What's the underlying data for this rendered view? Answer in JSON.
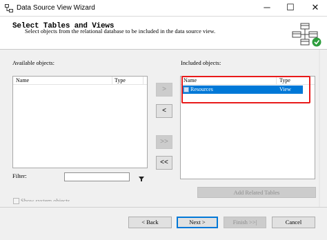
{
  "window": {
    "title": "Data Source View Wizard",
    "min_glyph": "─",
    "max_glyph": "☐",
    "close_glyph": "✕"
  },
  "header": {
    "title": "Select Tables and Views",
    "subtitle": "Select objects from the relational database to be included in the data source view."
  },
  "available": {
    "label": "Available objects:",
    "columns": [
      "Name",
      "Type"
    ],
    "rows": []
  },
  "included": {
    "label": "Included objects:",
    "columns": [
      "Name",
      "Type"
    ],
    "rows": [
      {
        "name": "Resources",
        "type": "View",
        "selected": true
      }
    ]
  },
  "move_buttons": {
    "add": ">",
    "remove": "<",
    "add_all": ">>",
    "remove_all": "<<"
  },
  "filter": {
    "label": "Filter:",
    "value": ""
  },
  "add_related_label": "Add Related Tables",
  "show_system_objects_label": "Show system objects",
  "nav": {
    "back": "< Back",
    "next": "Next >",
    "finish": "Finish >>|",
    "cancel": "Cancel"
  },
  "colors": {
    "selection": "#0078d7",
    "highlight_box": "#e81919",
    "check_badge": "#2e9e3e"
  },
  "icons": {
    "app": "data-source-view-icon",
    "wizard": "table-diagram-check-icon",
    "filter": "funnel-icon"
  }
}
